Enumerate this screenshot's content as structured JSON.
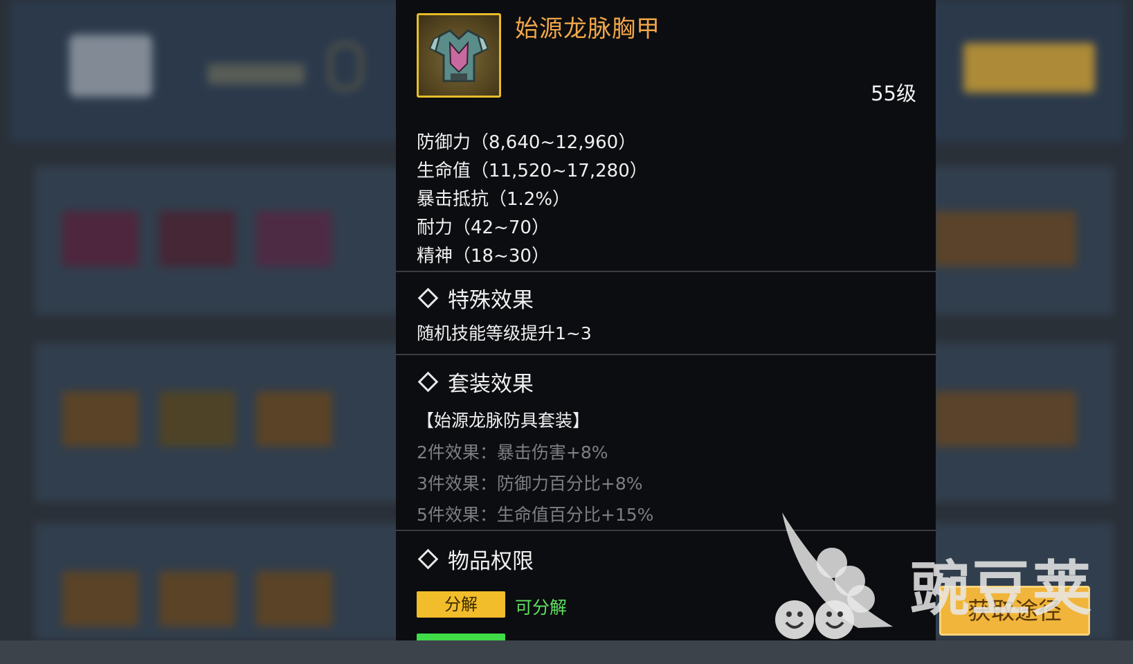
{
  "item": {
    "name": "始源龙脉胸甲",
    "level": "55级",
    "icon": "chest-armor-icon"
  },
  "stats": [
    "防御力（8,640~12,960）",
    "生命值（11,520~17,280）",
    "暴击抵抗（1.2%）",
    "耐力（42~70）",
    "精神（18~30）"
  ],
  "special": {
    "title": "特殊效果",
    "text": "随机技能等级提升1~3"
  },
  "set": {
    "title": "套装效果",
    "name": "【始源龙脉防具套装】",
    "effects": [
      "2件效果：暴击伤害+8%",
      "3件效果：防御力百分比+8%",
      "5件效果：生命值百分比+15%"
    ]
  },
  "permissions": {
    "title": "物品权限",
    "decompose_badge": "分解",
    "decompose_text": "可分解"
  },
  "acquire_button": "获取途径",
  "watermark": "豌豆荚",
  "colors": {
    "item_name": "#f0a64a",
    "icon_border": "#e7bd2b",
    "badge": "#f2bd2a",
    "green": "#5ee05e"
  }
}
